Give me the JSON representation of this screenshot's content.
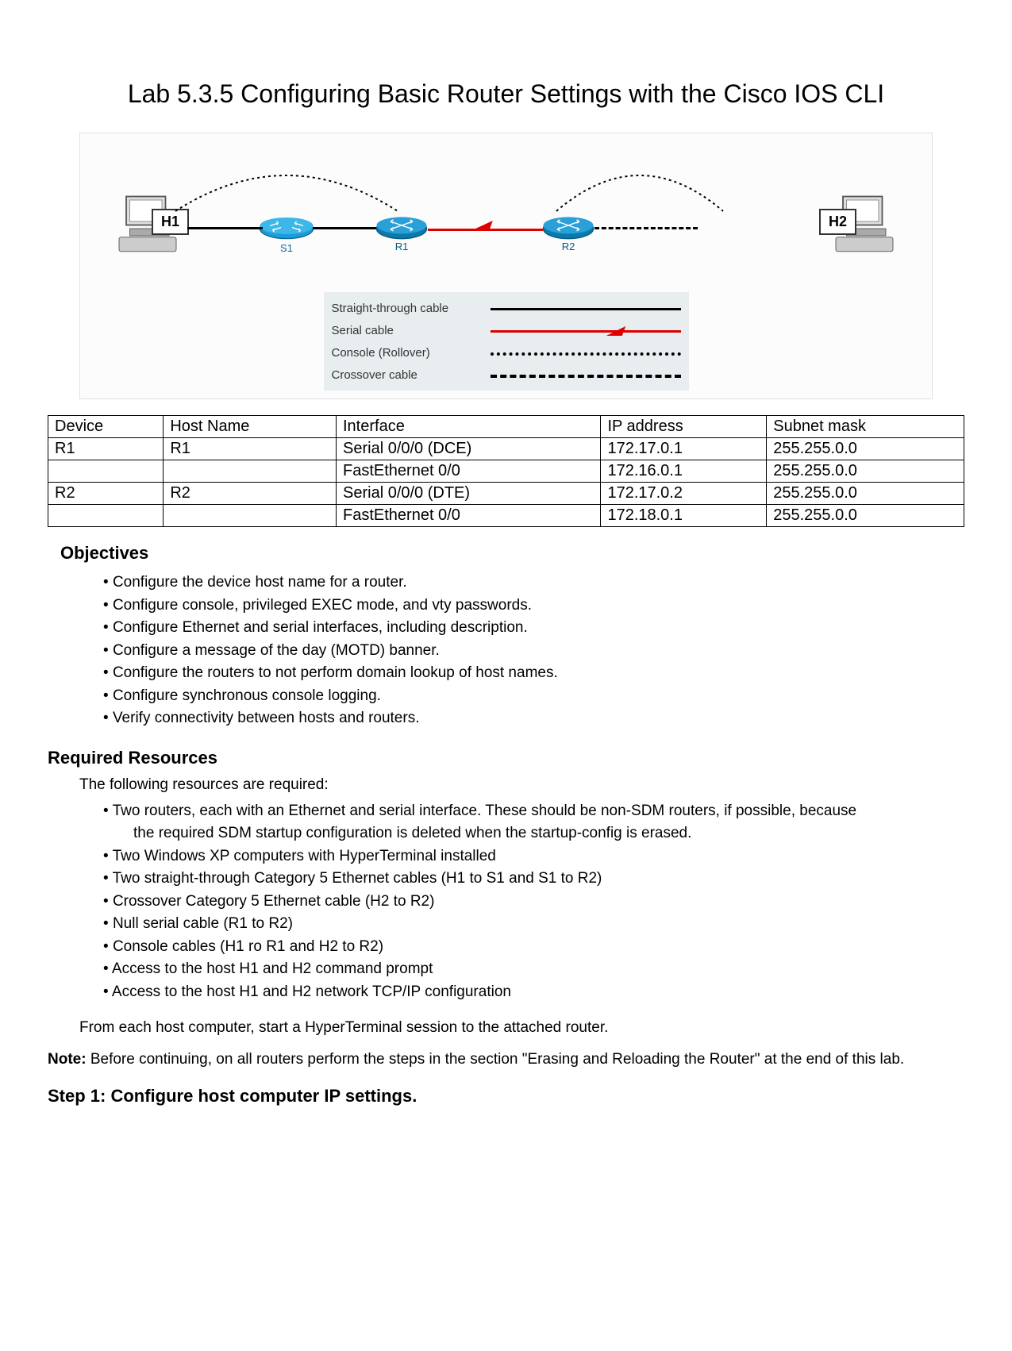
{
  "title": "Lab 5.3.5 Configuring Basic Router Settings with the Cisco IOS CLI",
  "topology": {
    "h1": "H1",
    "h2": "H2",
    "s1": "S1",
    "r1": "R1",
    "r2": "R2"
  },
  "legend": {
    "straight": "Straight-through cable",
    "serial": "Serial cable",
    "console": "Console (Rollover)",
    "crossover": "Crossover cable"
  },
  "table": {
    "headers": [
      "Device",
      "Host Name",
      "Interface",
      "IP address",
      "Subnet mask"
    ],
    "rows": [
      [
        "R1",
        "R1",
        "Serial 0/0/0 (DCE)",
        "172.17.0.1",
        "255.255.0.0"
      ],
      [
        "",
        "",
        "FastEthernet 0/0",
        "172.16.0.1",
        "255.255.0.0"
      ],
      [
        "R2",
        "R2",
        "Serial 0/0/0 (DTE)",
        "172.17.0.2",
        "255.255.0.0"
      ],
      [
        "",
        "",
        "FastEthernet 0/0",
        "172.18.0.1",
        "255.255.0.0"
      ]
    ]
  },
  "objectives_heading": "Objectives",
  "objectives": [
    "Configure the device host name for a router.",
    "Configure console, privileged EXEC mode, and vty passwords.",
    "Configure Ethernet and serial interfaces, including description.",
    "Configure a message of the day (MOTD) banner.",
    "Configure the routers to not perform domain lookup of host names.",
    "Configure synchronous console logging.",
    "Verify connectivity between hosts and routers."
  ],
  "resources_heading": "Required Resources",
  "resources_intro": "The following resources are required:",
  "resources": [
    {
      "main": "Two routers, each with an Ethernet and serial interface. These should be non-SDM routers, if possible, because",
      "sub": "the required SDM startup configuration is deleted when the startup-config is erased."
    },
    {
      "main": "Two Windows XP computers with HyperTerminal installed"
    },
    {
      "main": "Two straight-through Category 5 Ethernet cables (H1 to S1 and S1 to R2)"
    },
    {
      "main": "Crossover Category 5 Ethernet cable (H2 to R2)"
    },
    {
      "main": "Null serial cable (R1 to R2)"
    },
    {
      "main": "Console cables (H1 ro R1 and H2 to R2)"
    },
    {
      "main": "Access to the host H1 and H2 command prompt"
    },
    {
      "main": "Access to the host H1 and H2 network TCP/IP configuration"
    }
  ],
  "hyperterminal": "From each host computer, start a HyperTerminal session to the attached router.",
  "note_label": "Note:",
  "note_text": " Before continuing, on all routers perform the steps in the section \"Erasing and Reloading the Router\" at the end of this lab.",
  "step1": "Step 1: Configure host computer IP settings."
}
